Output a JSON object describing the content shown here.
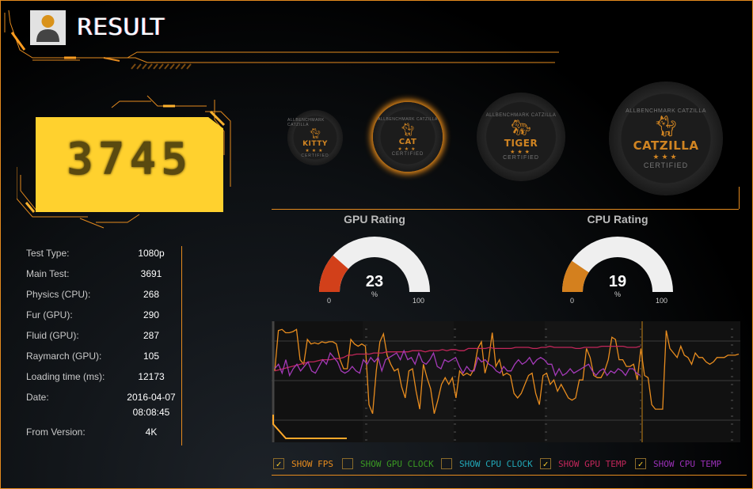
{
  "header": {
    "title": "RESULT",
    "avatar_icon": "user-avatar-icon"
  },
  "score": {
    "value": "3745"
  },
  "stats": [
    {
      "label": "Test Type:",
      "value": "1080p"
    },
    {
      "label": "Main Test:",
      "value": "3691"
    },
    {
      "label": "Physics (CPU):",
      "value": "268"
    },
    {
      "label": "Fur (GPU):",
      "value": "290"
    },
    {
      "label": "Fluid (GPU):",
      "value": "287"
    },
    {
      "label": "Raymarch (GPU):",
      "value": "105"
    },
    {
      "label": "Loading time (ms):",
      "value": "12173"
    },
    {
      "label": "Date:",
      "value": "2016-04-07",
      "value2": "08:08:45"
    },
    {
      "label": "From Version:",
      "value": "4K"
    }
  ],
  "badges": [
    {
      "name": "KITTY",
      "ring": "ALLBENCHMARK CATZILLA",
      "certified": "CERTIFIED",
      "active": false
    },
    {
      "name": "CAT",
      "ring": "ALLBENCHMARK CATZILLA",
      "certified": "CERTIFIED",
      "active": true
    },
    {
      "name": "TIGER",
      "ring": "ALLBENCHMARK CATZILLA",
      "certified": "CERTIFIED",
      "active": false
    },
    {
      "name": "CATZILLA",
      "ring": "ALLBENCHMARK CATZILLA",
      "certified": "CERTIFIED",
      "active": false
    }
  ],
  "gauges": [
    {
      "title": "GPU Rating",
      "value": 23,
      "value_label": "23",
      "unit": "%",
      "min": "0",
      "max": "100",
      "color": "#d2401a"
    },
    {
      "title": "CPU Rating",
      "value": 19,
      "value_label": "19",
      "unit": "%",
      "min": "0",
      "max": "100",
      "color": "#d4801e"
    }
  ],
  "chart_data": {
    "type": "line",
    "title": "",
    "xlabel": "",
    "ylabel": "",
    "ylim": [
      0,
      100
    ],
    "grid": true,
    "series": [
      {
        "name": "FPS",
        "color": "#e88c1e",
        "values": [
          60,
          96,
          97,
          94,
          94,
          95,
          97,
          70,
          66,
          88,
          84,
          85,
          84,
          86,
          85,
          86,
          86,
          84,
          70,
          62,
          62,
          88,
          84,
          82,
          84,
          82,
          30,
          22,
          60,
          86,
          93,
          74,
          66,
          60,
          62,
          46,
          36,
          60,
          62,
          42,
          26,
          66,
          54,
          44,
          22,
          34,
          48,
          54,
          48,
          54,
          36,
          60,
          56,
          58,
          56,
          62,
          80,
          86,
          58,
          70,
          94,
          64,
          70,
          56,
          58,
          56,
          40,
          36,
          40,
          48,
          56,
          58,
          40,
          30,
          56,
          58,
          48,
          52,
          42,
          48,
          42,
          36,
          34,
          36,
          52,
          52,
          80,
          72,
          56,
          54,
          54,
          60,
          70,
          90,
          88,
          70,
          70,
          64,
          64,
          66,
          52,
          80,
          56,
          54,
          30,
          26,
          26,
          26,
          96,
          80,
          76,
          72,
          82,
          74,
          72,
          66,
          76,
          72,
          72,
          68,
          66,
          68,
          72,
          72,
          72,
          74,
          74,
          74,
          75
        ]
      },
      {
        "name": "GPU Temp",
        "color": "#c2265a",
        "values": [
          60,
          61,
          62,
          63,
          64,
          65,
          66,
          67,
          68,
          68,
          69,
          70,
          70,
          70,
          71,
          71,
          72,
          74,
          74,
          75,
          75,
          75,
          75,
          76,
          76,
          76,
          77,
          77,
          77,
          77,
          77,
          77,
          78,
          78,
          78,
          77,
          78,
          78,
          78,
          79,
          78,
          79,
          79,
          78,
          78,
          80,
          80,
          80,
          80,
          80,
          81,
          80,
          80,
          80,
          80,
          80,
          81,
          81,
          81,
          81,
          80,
          80,
          81,
          81,
          82,
          81,
          81,
          81,
          81,
          81,
          80,
          80,
          81,
          81,
          81,
          81,
          82,
          82,
          82,
          82,
          82,
          82,
          81,
          81,
          81,
          82
        ]
      },
      {
        "name": "CPU Temp",
        "color": "#a43ab8",
        "values": [
          62,
          66,
          58,
          70,
          56,
          62,
          66,
          60,
          64,
          68,
          60,
          58,
          64,
          70,
          66,
          76,
          72,
          68,
          60,
          58,
          60,
          64,
          60,
          58,
          70,
          66,
          72,
          68,
          72,
          60,
          70,
          72,
          74,
          76,
          70,
          78,
          70,
          72,
          66,
          76,
          68,
          66,
          70,
          76,
          64,
          62,
          70,
          68,
          70,
          72,
          64,
          58,
          64,
          60,
          60,
          72,
          68,
          70,
          66,
          64,
          60,
          58,
          64,
          60,
          60,
          66,
          70,
          66,
          68,
          72,
          66,
          70,
          72,
          70,
          66,
          66,
          56,
          62,
          56,
          58,
          62,
          58,
          60,
          62,
          64,
          66,
          60,
          56,
          60,
          62,
          56,
          60,
          58,
          62,
          60,
          56,
          62,
          62,
          58,
          56
        ]
      }
    ]
  },
  "options": [
    {
      "label": "SHOW FPS",
      "checked": true,
      "color": "#e88c1e"
    },
    {
      "label": "SHOW GPU CLOCK",
      "checked": false,
      "color": "#3a9a22"
    },
    {
      "label": "SHOW CPU CLOCK",
      "checked": false,
      "color": "#22a8b8"
    },
    {
      "label": "SHOW GPU TEMP",
      "checked": true,
      "color": "#c2265a"
    },
    {
      "label": "SHOW CPU TEMP",
      "checked": true,
      "color": "#9a30b8"
    }
  ]
}
